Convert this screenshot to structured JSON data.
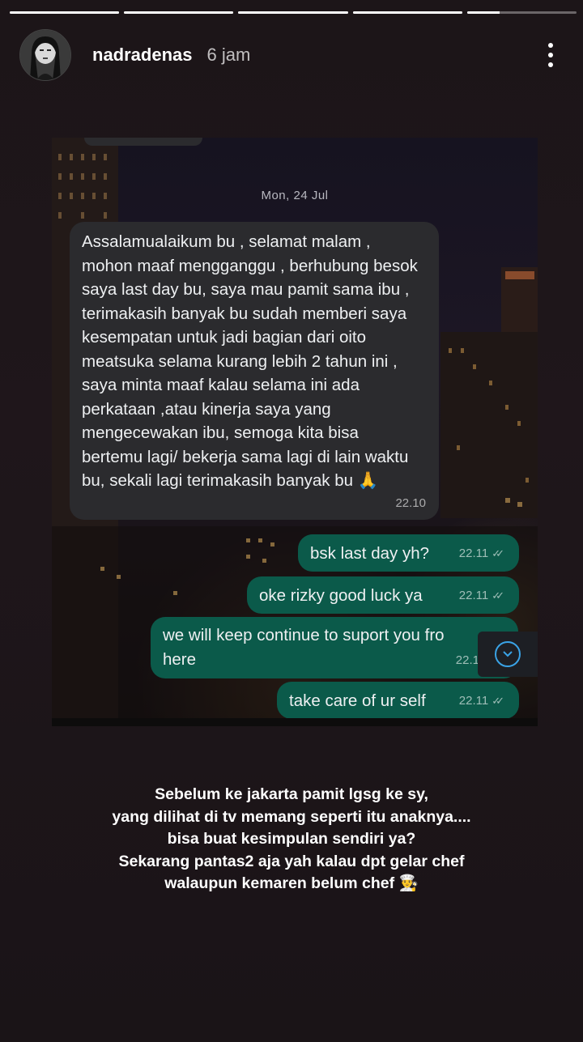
{
  "story": {
    "progress_segments": [
      1,
      1,
      1,
      1,
      0.3
    ],
    "username": "nadradenas",
    "time_ago": "6 jam"
  },
  "chat": {
    "date": "Mon, 24 Jul",
    "incoming": {
      "text": "Assalamualaikum bu , selamat malam , mohon maaf mengganggu , berhubung besok saya last day bu, saya mau pamit sama ibu , terimakasih banyak bu sudah memberi saya kesempatan untuk jadi bagian dari oito meatsuka selama kurang lebih 2 tahun ini , saya minta maaf kalau selama ini ada perkataan ,atau kinerja saya yang mengecewakan ibu, semoga kita bisa bertemu lagi/ bekerja sama lagi di lain waktu bu,  sekali lagi terimakasih banyak bu 🙏",
      "time": "22.10"
    },
    "outgoing": [
      {
        "text": "bsk last day yh?",
        "time": "22.11"
      },
      {
        "text": "oke rizky good luck ya",
        "time": "22.11"
      },
      {
        "text": "we will keep continue to suport you fro",
        "text2": "here",
        "time": "22.1"
      },
      {
        "text": "take care of ur self",
        "time": "22.11"
      }
    ]
  },
  "caption": {
    "lines": [
      "Sebelum ke jakarta pamit lgsg ke sy,",
      "yang dilihat di tv memang seperti itu anaknya....",
      "bisa buat kesimpulan sendiri ya?",
      "Sekarang pantas2 aja yah kalau dpt gelar chef",
      "walaupun kemaren belum chef 👨‍🍳"
    ]
  }
}
